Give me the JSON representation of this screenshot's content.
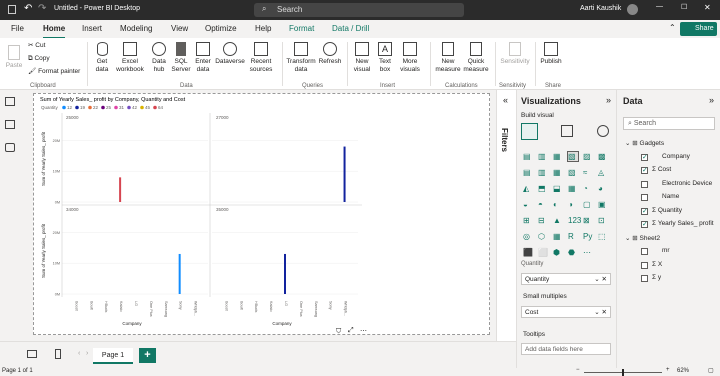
{
  "titlebar": {
    "app_title": "Untitled - Power BI Desktop",
    "search_placeholder": "Search",
    "user": "Aarti Kaushik"
  },
  "tabs": [
    "File",
    "Home",
    "Insert",
    "Modeling",
    "View",
    "Optimize",
    "Help",
    "Format",
    "Data / Drill"
  ],
  "ribbon": {
    "paste": "Paste",
    "cut": "Cut",
    "copy": "Copy",
    "format_painter": "Format painter",
    "get_data": "Get data",
    "excel_workbook": "Excel workbook",
    "data_hub": "Data hub",
    "sql_server": "SQL Server",
    "enter_data": "Enter data",
    "dataverse": "Dataverse",
    "recent_sources": "Recent sources",
    "transform_data": "Transform data",
    "refresh": "Refresh",
    "new_visual": "New visual",
    "text_box": "Text box",
    "more_visuals": "More visuals",
    "new_measure": "New measure",
    "quick_measure": "Quick measure",
    "sensitivity": "Sensitivity",
    "publish": "Publish",
    "share": "Share",
    "groups": {
      "clipboard": "Clipboard",
      "data": "Data",
      "queries": "Queries",
      "insert": "Insert",
      "calculations": "Calculations",
      "sensitivity": "Sensitivity",
      "share": "Share"
    }
  },
  "visual": {
    "title": "Sum of Yearly Sales_ profit by Company, Quantity and Cost",
    "legend_label": "Quantity",
    "legend_items": [
      "12",
      "19",
      "22",
      "25",
      "31",
      "42",
      "45",
      "64"
    ],
    "legend_colors": [
      "#118dff",
      "#12239e",
      "#e66c37",
      "#6b007b",
      "#e044a7",
      "#744ec2",
      "#d9b300",
      "#d64550"
    ],
    "ylabel": "Sum of Yearly Sales_ profit",
    "xlabel": "Company",
    "yticks": [
      "20M",
      "10M",
      "0M"
    ],
    "footer_icons": [
      "filter-icon",
      "focus-mode-icon",
      "more-options-icon"
    ]
  },
  "chart_data": {
    "type": "bar",
    "title": "Sum of Yearly Sales_ profit by Company, Quantity and Cost",
    "xlabel": "Company",
    "ylabel": "Sum of Yearly Sales_ profit",
    "small_multiples": "Cost",
    "legend": "Quantity",
    "categories": [
      "Boost",
      "Boult",
      "HBuds",
      "Kalalo",
      "LG",
      "One Plus",
      "Samsung",
      "Sony",
      "Wrldph..."
    ],
    "panels": [
      {
        "title": "25000",
        "bar_category": "Kalalo",
        "bar_value": 8,
        "color": "#d64550"
      },
      {
        "title": "27000",
        "bar_category": "Wrldph...",
        "bar_value": 18,
        "color": "#12239e"
      },
      {
        "title": "34000",
        "bar_category": "Sony",
        "bar_value": 13,
        "color": "#118dff"
      },
      {
        "title": "35000",
        "bar_category": "LG",
        "bar_value": 13,
        "color": "#12239e"
      }
    ],
    "ylim": [
      0,
      25
    ],
    "ytick_labels": [
      "0M",
      "10M",
      "20M"
    ]
  },
  "filters_label": "Filters",
  "viz_pane": {
    "title": "Visualizations",
    "build_visual": "Build visual",
    "fields": [
      {
        "label": "Quantity"
      },
      {
        "label": "Small multiples",
        "value": "Cost"
      },
      {
        "label": "Tooltips",
        "placeholder": "Add data fields here"
      }
    ]
  },
  "data_pane": {
    "title": "Data",
    "search_placeholder": "Search",
    "tables": [
      {
        "name": "Gadgets",
        "fields": [
          {
            "name": "Company",
            "checked": true,
            "sigma": false
          },
          {
            "name": "Cost",
            "checked": true,
            "sigma": true
          },
          {
            "name": "Electronic Device",
            "checked": false,
            "sigma": false
          },
          {
            "name": "Name",
            "checked": false,
            "sigma": false
          },
          {
            "name": "Quantity",
            "checked": true,
            "sigma": true
          },
          {
            "name": "Yearly Sales_ profit",
            "checked": true,
            "sigma": true
          }
        ]
      },
      {
        "name": "Sheet2",
        "fields": [
          {
            "name": "mr",
            "checked": false,
            "sigma": false
          },
          {
            "name": "X",
            "checked": false,
            "sigma": true
          },
          {
            "name": "y",
            "checked": false,
            "sigma": true
          }
        ]
      }
    ]
  },
  "bottom": {
    "page_tab": "Page 1",
    "add_page": "+"
  },
  "status": {
    "page_info": "Page 1 of 1",
    "zoom": "62%"
  }
}
